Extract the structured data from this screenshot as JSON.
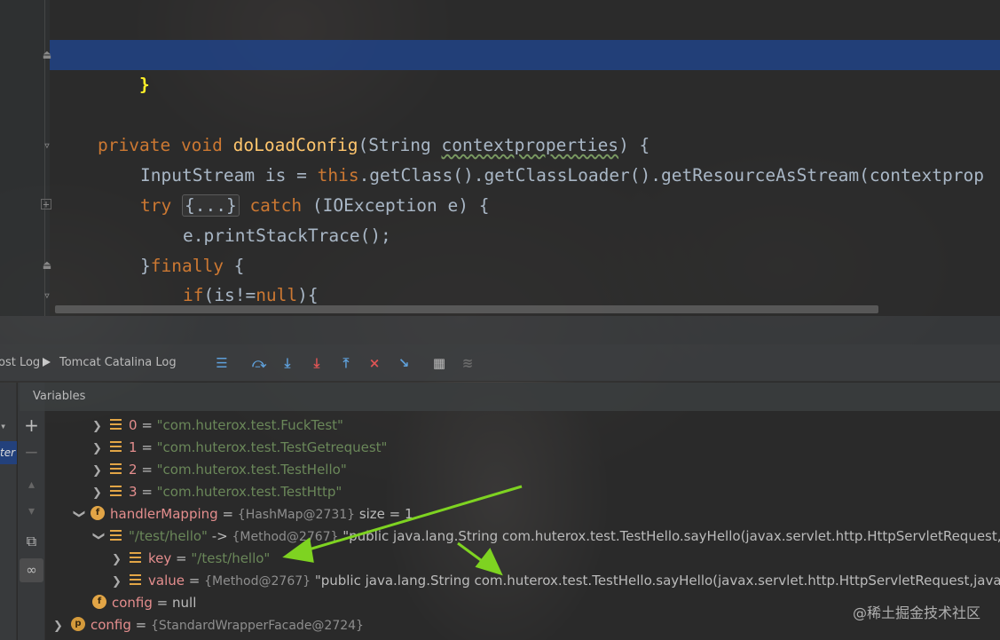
{
  "editor": {
    "lines": [
      {
        "brace": "}"
      },
      {
        "kw1": "private",
        "kw2": "void",
        "name": "doLoadConfig",
        "params_open": "(String ",
        "param": "contextproperties",
        "params_close": ") {"
      },
      {
        "type": "InputStream is = ",
        "kw": "this",
        "rest": ".getClass().getClassLoader().getResourceAsStream(contextprop"
      },
      {
        "kw_try": "try",
        "fold": "{...}",
        "kw_catch": "catch",
        "rest": " (IOException e) {"
      },
      {
        "text": "e.printStackTrace();"
      },
      {
        "brace": "}",
        "kw": "finally",
        "rest": " {"
      },
      {
        "kw": "if",
        "rest": "(is!=",
        "kw_null": "null",
        "end": "){"
      }
    ]
  },
  "toolbar": {
    "tab_host_log": "ost Log",
    "tab_tomcat_log": "Tomcat Catalina Log",
    "buttons": [
      "menu",
      "step-over",
      "step-into",
      "force-step-into",
      "step-out",
      "drop-frame",
      "run-to-cursor",
      "evaluate",
      "trace"
    ]
  },
  "variables": {
    "header": "Variables",
    "rows": [
      {
        "index": "0",
        "eq": " = ",
        "value": "\"com.huterox.test.FuckTest\""
      },
      {
        "index": "1",
        "eq": " = ",
        "value": "\"com.huterox.test.TestGetrequest\""
      },
      {
        "index": "2",
        "eq": " = ",
        "value": "\"com.huterox.test.TestHello\""
      },
      {
        "index": "3",
        "eq": " = ",
        "value": "\"com.huterox.test.TestHttp\""
      }
    ],
    "handler_mapping": {
      "icon": "f",
      "name": "handlerMapping",
      "eq": " = ",
      "ref": "{HashMap@2731}",
      "extra": "  size = 1"
    },
    "entry": {
      "key": "\"/test/hello\"",
      "arrow": " -> ",
      "ref": "{Method@2767}",
      "value": " \"public java.lang.String com.huterox.test.TestHello.sayHello(javax.servlet.http.HttpServletRequest,jav"
    },
    "key_row": {
      "name": "key",
      "eq": " = ",
      "value": "\"/test/hello\""
    },
    "value_row": {
      "name": "value",
      "eq": " = ",
      "ref": "{Method@2767}",
      "value": " \"public java.lang.String com.huterox.test.TestHello.sayHello(javax.servlet.http.HttpServletRequest,javax.se"
    },
    "config_row": {
      "icon": "f",
      "name": "config",
      "eq": " = ",
      "value": "null"
    },
    "config_outer": {
      "icon": "p",
      "name": "config",
      "eq": " = ",
      "ref": "{StandardWrapperFacade@2724}"
    }
  },
  "frames_strip": {
    "partial_label": "ter"
  },
  "watermark": "@稀土掘金技术社区",
  "colors": {
    "keyword": "#cc7832",
    "method": "#ffc66d",
    "string": "#6a8759",
    "selection": "#214283",
    "arrow": "#7ed321"
  }
}
